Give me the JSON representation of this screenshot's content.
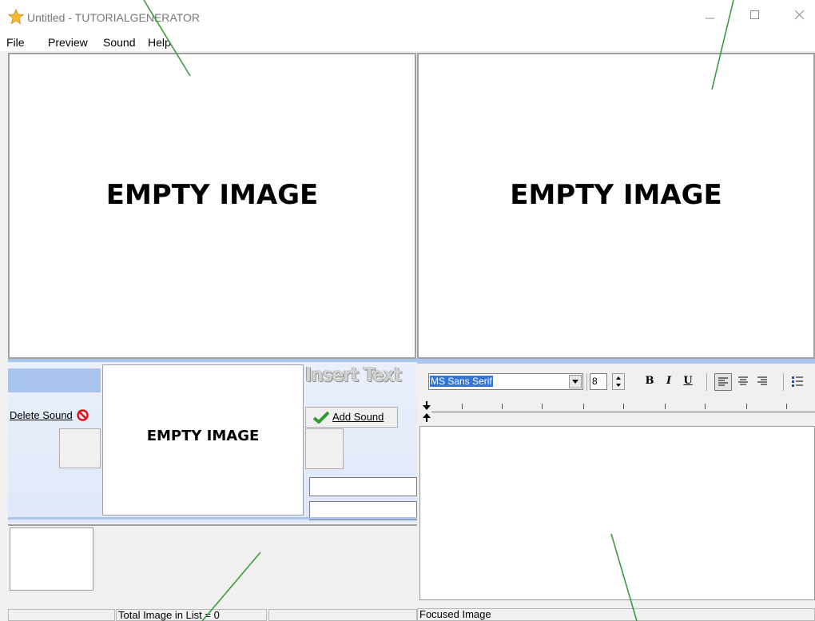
{
  "window": {
    "title": "Untitled - TUTORIALGENERATOR"
  },
  "menu": [
    "File",
    "Preview",
    "Sound",
    "Help"
  ],
  "previews": {
    "left_label": "EMPTY IMAGE",
    "right_label": "EMPTY IMAGE",
    "thumb_label": "EMPTY IMAGE"
  },
  "sound_panel": {
    "delete_label": "Delete Sound",
    "add_label": "Add Sound",
    "insert_text_label": "Insert Text"
  },
  "editor_toolbar": {
    "font_name": "MS Sans Serif",
    "font_size": "8",
    "bold": "B",
    "italic": "I",
    "underline": "U"
  },
  "status": {
    "image_count": "Total Image in List = 0",
    "focus": "Focused Image"
  },
  "colors": {
    "panel_bg": "#e3ebfa",
    "accent_bar": "#a9c5ee",
    "font_highlight": "#3476d8",
    "arrow": "#3c9a3c"
  }
}
